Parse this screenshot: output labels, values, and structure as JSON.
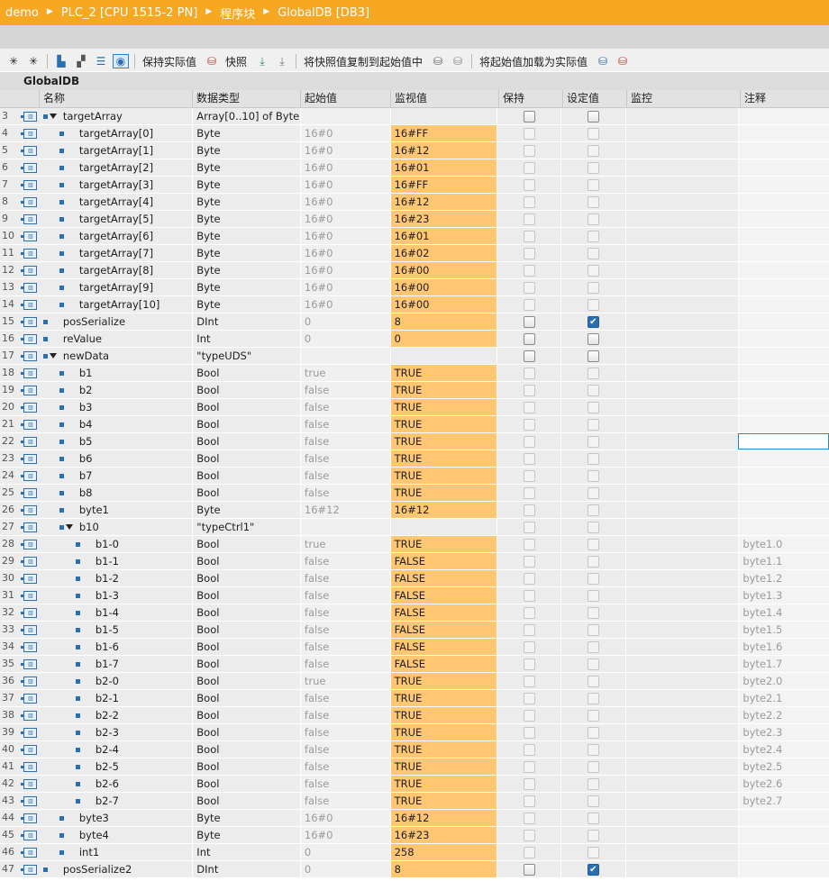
{
  "breadcrumb": [
    "demo",
    "PLC_2 [CPU 1515-2 PN]",
    "程序块",
    "GlobalDB [DB3]"
  ],
  "toolbar": {
    "keep_actual": "保持实际值",
    "snapshot": "快照",
    "copy_snapshot": "将快照值复制到起始值中",
    "load_start": "将起始值加载为实际值"
  },
  "block_name": "GlobalDB",
  "headers": {
    "name": "名称",
    "type": "数据类型",
    "start": "起始值",
    "monitor": "监视值",
    "retain": "保持",
    "setpoint": "设定值",
    "supervision": "监控",
    "comment": "注释"
  },
  "rows": [
    {
      "n": "3",
      "level": 0,
      "expand": true,
      "name": "targetArray",
      "type": "Array[0..10] of Byte",
      "start": "",
      "mon": "",
      "retain": "normal",
      "set": "normal",
      "cmt": ""
    },
    {
      "n": "4",
      "level": 1,
      "name": "targetArray[0]",
      "type": "Byte",
      "start": "16#0",
      "mon": "16#FF",
      "retain": "dim",
      "set": "dim",
      "cmt": ""
    },
    {
      "n": "5",
      "level": 1,
      "name": "targetArray[1]",
      "type": "Byte",
      "start": "16#0",
      "mon": "16#12",
      "retain": "dim",
      "set": "dim",
      "cmt": ""
    },
    {
      "n": "6",
      "level": 1,
      "name": "targetArray[2]",
      "type": "Byte",
      "start": "16#0",
      "mon": "16#01",
      "retain": "dim",
      "set": "dim",
      "cmt": ""
    },
    {
      "n": "7",
      "level": 1,
      "name": "targetArray[3]",
      "type": "Byte",
      "start": "16#0",
      "mon": "16#FF",
      "retain": "dim",
      "set": "dim",
      "cmt": ""
    },
    {
      "n": "8",
      "level": 1,
      "name": "targetArray[4]",
      "type": "Byte",
      "start": "16#0",
      "mon": "16#12",
      "retain": "dim",
      "set": "dim",
      "cmt": ""
    },
    {
      "n": "9",
      "level": 1,
      "name": "targetArray[5]",
      "type": "Byte",
      "start": "16#0",
      "mon": "16#23",
      "retain": "dim",
      "set": "dim",
      "cmt": ""
    },
    {
      "n": "10",
      "level": 1,
      "name": "targetArray[6]",
      "type": "Byte",
      "start": "16#0",
      "mon": "16#01",
      "retain": "dim",
      "set": "dim",
      "cmt": ""
    },
    {
      "n": "11",
      "level": 1,
      "name": "targetArray[7]",
      "type": "Byte",
      "start": "16#0",
      "mon": "16#02",
      "retain": "dim",
      "set": "dim",
      "cmt": ""
    },
    {
      "n": "12",
      "level": 1,
      "name": "targetArray[8]",
      "type": "Byte",
      "start": "16#0",
      "mon": "16#00",
      "retain": "dim",
      "set": "dim",
      "cmt": ""
    },
    {
      "n": "13",
      "level": 1,
      "name": "targetArray[9]",
      "type": "Byte",
      "start": "16#0",
      "mon": "16#00",
      "retain": "dim",
      "set": "dim",
      "cmt": ""
    },
    {
      "n": "14",
      "level": 1,
      "name": "targetArray[10]",
      "type": "Byte",
      "start": "16#0",
      "mon": "16#00",
      "retain": "dim",
      "set": "dim",
      "cmt": ""
    },
    {
      "n": "15",
      "level": 0,
      "name": "posSerialize",
      "type": "DInt",
      "start": "0",
      "mon": "8",
      "retain": "normal",
      "set": "checked",
      "cmt": ""
    },
    {
      "n": "16",
      "level": 0,
      "name": "reValue",
      "type": "Int",
      "start": "0",
      "mon": "0",
      "retain": "normal",
      "set": "normal",
      "cmt": ""
    },
    {
      "n": "17",
      "level": 0,
      "expand": true,
      "name": "newData",
      "type": "\"typeUDS\"",
      "start": "",
      "mon": "",
      "retain": "normal",
      "set": "normal",
      "cmt": ""
    },
    {
      "n": "18",
      "level": 1,
      "name": "b1",
      "type": "Bool",
      "start": "true",
      "mon": "TRUE",
      "retain": "dim",
      "set": "dim",
      "cmt": ""
    },
    {
      "n": "19",
      "level": 1,
      "name": "b2",
      "type": "Bool",
      "start": "false",
      "mon": "TRUE",
      "retain": "dim",
      "set": "dim",
      "cmt": ""
    },
    {
      "n": "20",
      "level": 1,
      "name": "b3",
      "type": "Bool",
      "start": "false",
      "mon": "TRUE",
      "retain": "dim",
      "set": "dim",
      "cmt": ""
    },
    {
      "n": "21",
      "level": 1,
      "name": "b4",
      "type": "Bool",
      "start": "false",
      "mon": "TRUE",
      "retain": "dim",
      "set": "dim",
      "cmt": ""
    },
    {
      "n": "22",
      "level": 1,
      "name": "b5",
      "type": "Bool",
      "start": "false",
      "mon": "TRUE",
      "retain": "dim",
      "set": "dim",
      "cmt": "",
      "focus": true
    },
    {
      "n": "23",
      "level": 1,
      "name": "b6",
      "type": "Bool",
      "start": "false",
      "mon": "TRUE",
      "retain": "dim",
      "set": "dim",
      "cmt": ""
    },
    {
      "n": "24",
      "level": 1,
      "name": "b7",
      "type": "Bool",
      "start": "false",
      "mon": "TRUE",
      "retain": "dim",
      "set": "dim",
      "cmt": ""
    },
    {
      "n": "25",
      "level": 1,
      "name": "b8",
      "type": "Bool",
      "start": "false",
      "mon": "TRUE",
      "retain": "dim",
      "set": "dim",
      "cmt": ""
    },
    {
      "n": "26",
      "level": 1,
      "name": "byte1",
      "type": "Byte",
      "start": "16#12",
      "mon": "16#12",
      "retain": "dim",
      "set": "dim",
      "cmt": ""
    },
    {
      "n": "27",
      "level": 1,
      "expand": true,
      "name": "b10",
      "type": "\"typeCtrl1\"",
      "start": "",
      "mon": "",
      "retain": "dim",
      "set": "dim",
      "cmt": ""
    },
    {
      "n": "28",
      "level": 2,
      "name": "b1-0",
      "type": "Bool",
      "start": "true",
      "mon": "TRUE",
      "retain": "dim",
      "set": "dim",
      "cmt": "byte1.0"
    },
    {
      "n": "29",
      "level": 2,
      "name": "b1-1",
      "type": "Bool",
      "start": "false",
      "mon": "FALSE",
      "retain": "dim",
      "set": "dim",
      "cmt": "byte1.1"
    },
    {
      "n": "30",
      "level": 2,
      "name": "b1-2",
      "type": "Bool",
      "start": "false",
      "mon": "FALSE",
      "retain": "dim",
      "set": "dim",
      "cmt": "byte1.2"
    },
    {
      "n": "31",
      "level": 2,
      "name": "b1-3",
      "type": "Bool",
      "start": "false",
      "mon": "FALSE",
      "retain": "dim",
      "set": "dim",
      "cmt": "byte1.3"
    },
    {
      "n": "32",
      "level": 2,
      "name": "b1-4",
      "type": "Bool",
      "start": "false",
      "mon": "FALSE",
      "retain": "dim",
      "set": "dim",
      "cmt": "byte1.4"
    },
    {
      "n": "33",
      "level": 2,
      "name": "b1-5",
      "type": "Bool",
      "start": "false",
      "mon": "FALSE",
      "retain": "dim",
      "set": "dim",
      "cmt": "byte1.5"
    },
    {
      "n": "34",
      "level": 2,
      "name": "b1-6",
      "type": "Bool",
      "start": "false",
      "mon": "FALSE",
      "retain": "dim",
      "set": "dim",
      "cmt": "byte1.6"
    },
    {
      "n": "35",
      "level": 2,
      "name": "b1-7",
      "type": "Bool",
      "start": "false",
      "mon": "FALSE",
      "retain": "dim",
      "set": "dim",
      "cmt": "byte1.7"
    },
    {
      "n": "36",
      "level": 2,
      "name": "b2-0",
      "type": "Bool",
      "start": "true",
      "mon": "TRUE",
      "retain": "dim",
      "set": "dim",
      "cmt": "byte2.0"
    },
    {
      "n": "37",
      "level": 2,
      "name": "b2-1",
      "type": "Bool",
      "start": "false",
      "mon": "TRUE",
      "retain": "dim",
      "set": "dim",
      "cmt": "byte2.1"
    },
    {
      "n": "38",
      "level": 2,
      "name": "b2-2",
      "type": "Bool",
      "start": "false",
      "mon": "TRUE",
      "retain": "dim",
      "set": "dim",
      "cmt": "byte2.2"
    },
    {
      "n": "39",
      "level": 2,
      "name": "b2-3",
      "type": "Bool",
      "start": "false",
      "mon": "TRUE",
      "retain": "dim",
      "set": "dim",
      "cmt": "byte2.3"
    },
    {
      "n": "40",
      "level": 2,
      "name": "b2-4",
      "type": "Bool",
      "start": "false",
      "mon": "TRUE",
      "retain": "dim",
      "set": "dim",
      "cmt": "byte2.4"
    },
    {
      "n": "41",
      "level": 2,
      "name": "b2-5",
      "type": "Bool",
      "start": "false",
      "mon": "TRUE",
      "retain": "dim",
      "set": "dim",
      "cmt": "byte2.5"
    },
    {
      "n": "42",
      "level": 2,
      "name": "b2-6",
      "type": "Bool",
      "start": "false",
      "mon": "TRUE",
      "retain": "dim",
      "set": "dim",
      "cmt": "byte2.6"
    },
    {
      "n": "43",
      "level": 2,
      "name": "b2-7",
      "type": "Bool",
      "start": "false",
      "mon": "TRUE",
      "retain": "dim",
      "set": "dim",
      "cmt": "byte2.7"
    },
    {
      "n": "44",
      "level": 1,
      "name": "byte3",
      "type": "Byte",
      "start": "16#0",
      "mon": "16#12",
      "retain": "dim",
      "set": "dim",
      "cmt": ""
    },
    {
      "n": "45",
      "level": 1,
      "name": "byte4",
      "type": "Byte",
      "start": "16#0",
      "mon": "16#23",
      "retain": "dim",
      "set": "dim",
      "cmt": ""
    },
    {
      "n": "46",
      "level": 1,
      "name": "int1",
      "type": "Int",
      "start": "0",
      "mon": "258",
      "retain": "dim",
      "set": "dim",
      "cmt": ""
    },
    {
      "n": "47",
      "level": 0,
      "name": "posSerialize2",
      "type": "DInt",
      "start": "0",
      "mon": "8",
      "retain": "normal",
      "set": "checked",
      "cmt": ""
    }
  ],
  "colors": {
    "title_bar": "#f7a823",
    "monitor_value": "#ffc772",
    "icon_blue": "#2a6fb0"
  }
}
